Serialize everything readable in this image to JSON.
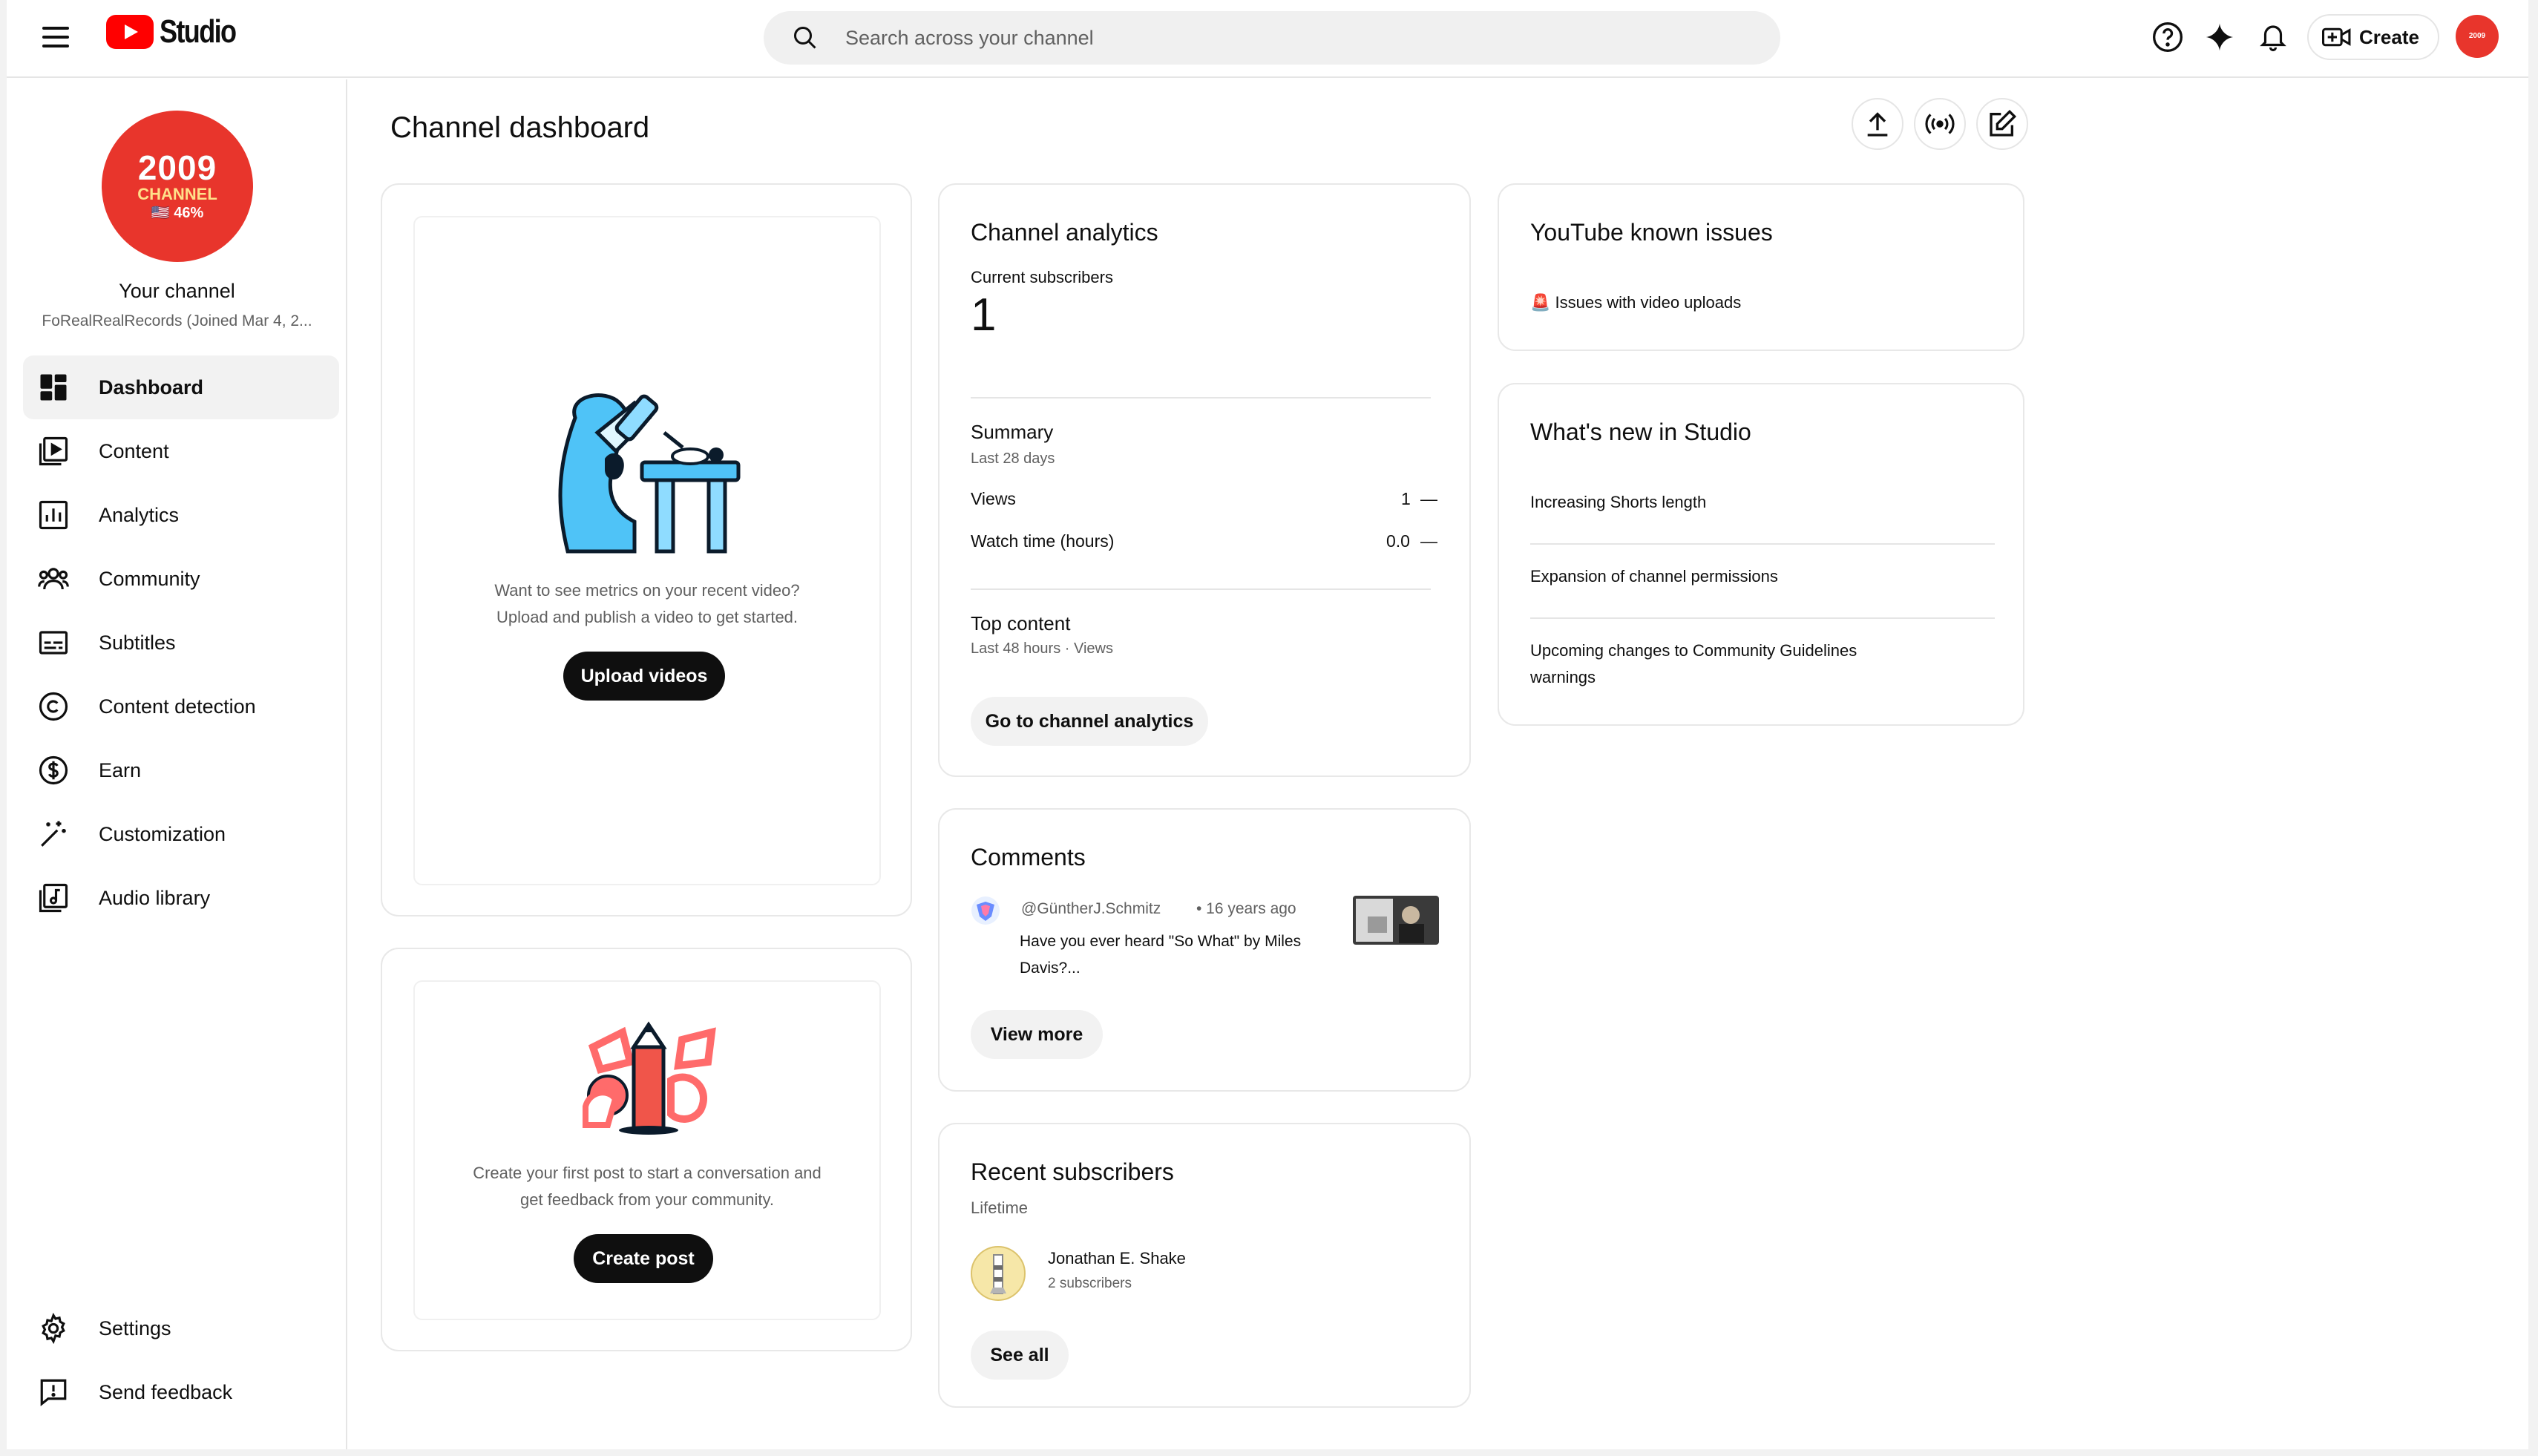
{
  "app": {
    "logo_text": "Studio"
  },
  "search": {
    "placeholder": "Search across your channel"
  },
  "topbar": {
    "create_label": "Create",
    "avatar_text": "2009"
  },
  "channel": {
    "avatar_line1": "2009",
    "avatar_line2": "CHANNEL",
    "avatar_line3": "🇺🇸 46%",
    "title": "Your channel",
    "subtitle": "FoRealRealRecords (Joined Mar 4, 2..."
  },
  "sidebar": {
    "items": [
      {
        "label": "Dashboard",
        "icon": "dashboard-icon",
        "active": true
      },
      {
        "label": "Content",
        "icon": "content-icon"
      },
      {
        "label": "Analytics",
        "icon": "analytics-icon"
      },
      {
        "label": "Community",
        "icon": "community-icon"
      },
      {
        "label": "Subtitles",
        "icon": "subtitles-icon"
      },
      {
        "label": "Content detection",
        "icon": "copyright-icon"
      },
      {
        "label": "Earn",
        "icon": "dollar-icon"
      },
      {
        "label": "Customization",
        "icon": "magic-wand-icon"
      },
      {
        "label": "Audio library",
        "icon": "audio-library-icon"
      }
    ],
    "bottom": [
      {
        "label": "Settings",
        "icon": "gear-icon"
      },
      {
        "label": "Send feedback",
        "icon": "feedback-icon"
      }
    ]
  },
  "page": {
    "title": "Channel dashboard"
  },
  "upload_card": {
    "text_line1": "Want to see metrics on your recent video?",
    "text_line2": "Upload and publish a video to get started.",
    "button": "Upload videos"
  },
  "post_card": {
    "text_line1": "Create your first post to start a conversation and",
    "text_line2": "get feedback from your community.",
    "button": "Create post"
  },
  "analytics": {
    "title": "Channel analytics",
    "subs_label": "Current subscribers",
    "subs_value": "1",
    "summary_title": "Summary",
    "summary_period": "Last 28 days",
    "views_label": "Views",
    "views_value": "1",
    "views_trend": "—",
    "watch_label": "Watch time (hours)",
    "watch_value": "0.0",
    "watch_trend": "—",
    "top_title": "Top content",
    "top_period": "Last 48 hours · Views",
    "button": "Go to channel analytics"
  },
  "comments": {
    "title": "Comments",
    "author": "@GüntherJ.Schmitz",
    "time": "• 16 years ago",
    "text_line1": "Have you ever heard \"So What\" by Miles",
    "text_line2": "Davis?...",
    "button": "View more"
  },
  "recent_subs": {
    "title": "Recent subscribers",
    "period": "Lifetime",
    "name": "Jonathan E. Shake",
    "count": "2 subscribers",
    "button": "See all"
  },
  "known_issues": {
    "title": "YouTube known issues",
    "item": "Issues with video uploads",
    "item_icon": "🚨"
  },
  "whats_new": {
    "title": "What's new in Studio",
    "items": [
      "Increasing Shorts length",
      "Expansion of channel permissions",
      "Upcoming changes to Community Guidelines",
      "warnings"
    ]
  },
  "colors": {
    "brand_red": "#ff0000",
    "accent": "#0f0f0f",
    "avatar_red": "#e8352c"
  }
}
